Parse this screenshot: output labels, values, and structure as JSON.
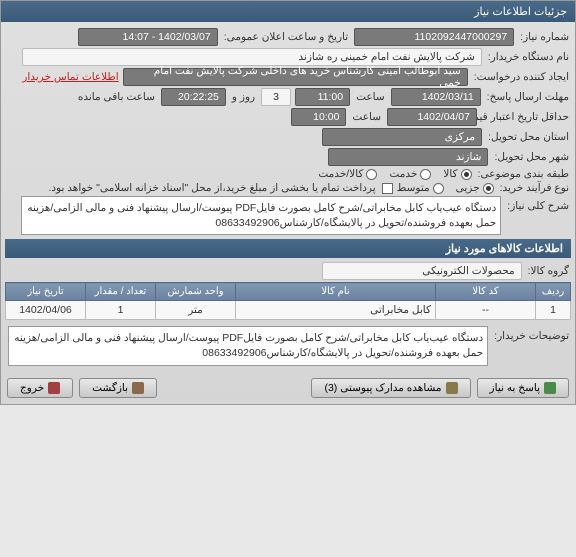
{
  "window": {
    "title": "جزئیات اطلاعات نیاز"
  },
  "labels": {
    "need_number": "شماره نیاز:",
    "announce_date": "تاریخ و ساعت اعلان عمومی:",
    "buyer_org": "نام دستگاه خریدار:",
    "requester": "ایجاد کننده درخواست:",
    "contact": "اطلاعات تماس خریدار",
    "deadline": "مهلت ارسال پاسخ:",
    "at": "ساعت",
    "days": "روز و",
    "remaining": "ساعت باقی مانده",
    "validity": "حداقل تاریخ اعتبار قیمت تا تاریخ:",
    "delivery_province": "استان محل تحویل:",
    "delivery_city": "شهر محل تحویل:",
    "category": "طبقه بندی موضوعی:",
    "purchase_type": "نوع فرآیند خرید:",
    "payment_note": "پرداخت تمام یا بخشی از مبلغ خرید،از محل \"اسناد خزانه اسلامی\" خواهد بود.",
    "need_desc": "شرح کلی نیاز:",
    "goods_group": "گروه کالا:",
    "buyer_notes": "توضیحات خریدار:"
  },
  "values": {
    "need_number": "1102092447000297",
    "announce_date": "1402/03/07 - 14:07",
    "buyer_org": "شرکت پالایش نفت امام خمینی  ره  شازند",
    "requester": "سید ابوطالب  امینی کارشناس خرید های داخلی  شرکت پالایش نفت امام خمی",
    "deadline_date": "1402/03/11",
    "deadline_time": "11:00",
    "days_remain": "3",
    "time_remain": "20:22:25",
    "validity_date": "1402/04/07",
    "validity_time": "10:00",
    "province": "مرکزی",
    "city": "شازند",
    "need_desc": "دستگاه عیب‌یاب کابل مخابراتی/شرح کامل بصورت فایلPDF پیوست/ارسال پیشنهاد فنی و مالی الزامی/هزینه حمل بعهده فروشنده/تحویل در پالایشگاه/کارشناس08633492906",
    "goods_group": "محصولات الکترونیکی",
    "buyer_notes": "دستگاه عیب‌یاب کابل مخابراتی/شرح کامل بصورت فایلPDF پیوست/ارسال پیشنهاد فنی و مالی الزامی/هزینه حمل بعهده فروشنده/تحویل در پالایشگاه/کارشناس08633492906"
  },
  "category_options": {
    "goods": "کالا",
    "service": "خدمت",
    "goods_service": "کالا/خدمت"
  },
  "purchase_options": {
    "minor": "جزیی",
    "medium": "متوسط"
  },
  "section2": {
    "title": "اطلاعات کالاهای مورد نیاز"
  },
  "table": {
    "headers": {
      "row": "ردیف",
      "code": "کد کالا",
      "name": "نام کالا",
      "unit": "واحد شمارش",
      "qty": "تعداد / مقدار",
      "date": "تاریخ نیاز"
    },
    "rows": [
      {
        "row": "1",
        "code": "--",
        "name": "کابل مخابراتی",
        "unit": "متر",
        "qty": "1",
        "date": "1402/04/06"
      }
    ]
  },
  "buttons": {
    "reply": "پاسخ به نیاز",
    "attachments": "مشاهده مدارک پیوستی (3)",
    "back": "بازگشت",
    "exit": "خروج"
  }
}
